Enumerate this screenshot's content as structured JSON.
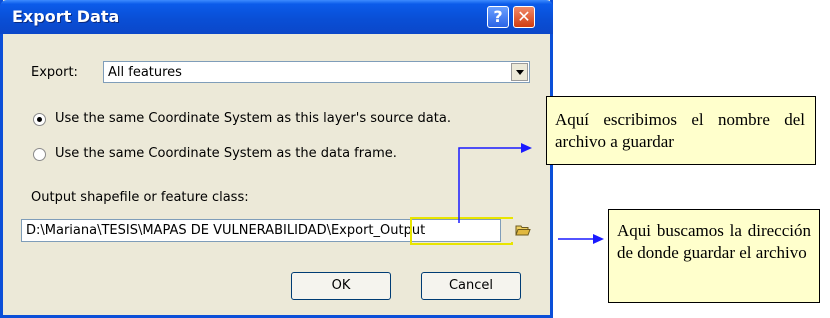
{
  "window": {
    "title": "Export Data",
    "help_glyph": "?",
    "close_glyph": "✕"
  },
  "export": {
    "label": "Export:",
    "value": "All features"
  },
  "radios": [
    {
      "label": "Use the same Coordinate System as this layer's source data.",
      "checked": true
    },
    {
      "label": "Use the same Coordinate System as the data frame.",
      "checked": false
    }
  ],
  "output": {
    "label": "Output shapefile or feature class:",
    "path": "D:\\Mariana\\TESIS\\MAPAS DE VULNERABILIDAD\\Export_Output"
  },
  "buttons": {
    "ok": "OK",
    "cancel": "Cancel"
  },
  "annotations": [
    {
      "text": "Aquí escribimos el nombre del archivo a guardar"
    },
    {
      "text": "Aqui buscamos la dirección de donde guardar el archivo"
    }
  ],
  "colors": {
    "annotation_bg": "#ffffcc",
    "arrow": "#1a1aff",
    "highlight": "#e8e500",
    "title_bar": "#0a4fd6"
  }
}
